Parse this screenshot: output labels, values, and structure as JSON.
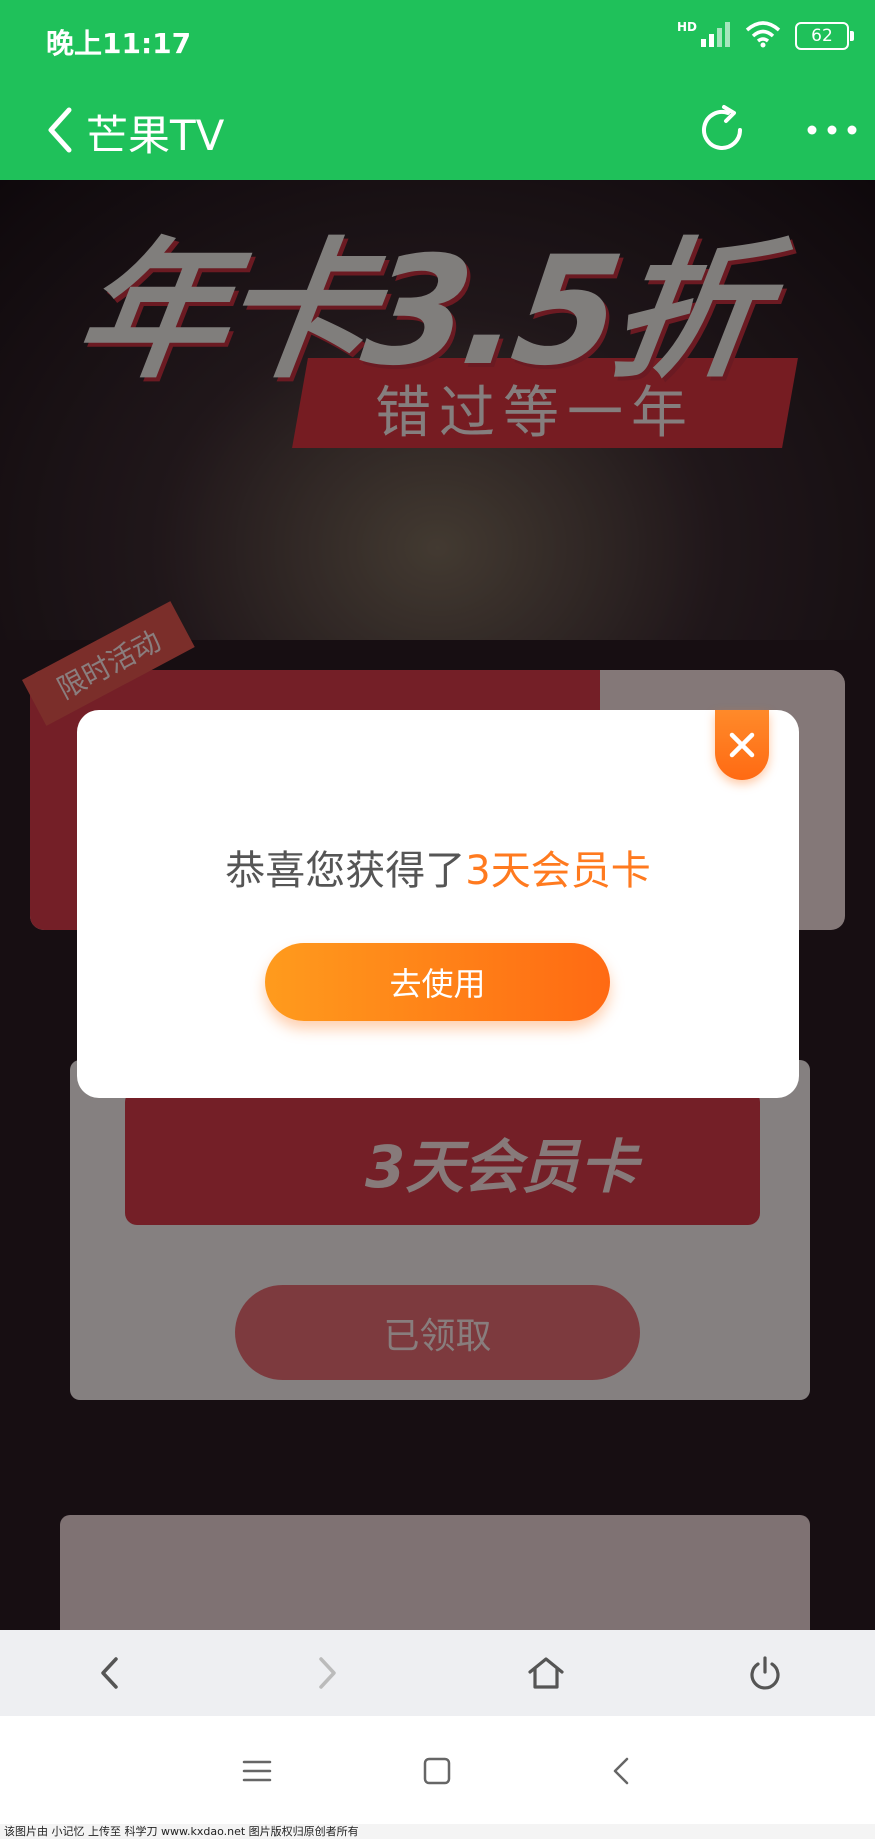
{
  "status_bar": {
    "time": "晚上11:17",
    "network": "HD",
    "battery": "62"
  },
  "app_bar": {
    "title": "芒果TV"
  },
  "page": {
    "hero_title": "年卡3.5折",
    "hero_subtitle": "错过等一年",
    "limited_tag": "限时活动",
    "card_title": "3天会员卡",
    "claimed_label": "已领取"
  },
  "dialog": {
    "message_prefix": "恭喜您获得了",
    "message_highlight": "3天会员卡",
    "use_button": "去使用"
  },
  "watermark": "该图片由 小记忆 上传至 科学刀 www.kxdao.net 图片版权归原创者所有",
  "colors": {
    "app_bar": "#1fc15a",
    "accent": "#ff7a1f",
    "banner_red": "#d33a47"
  }
}
